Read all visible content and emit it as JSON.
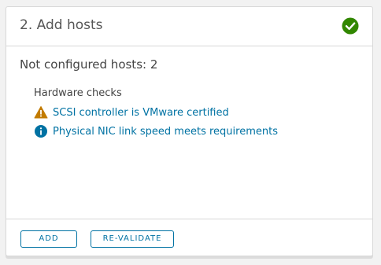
{
  "card": {
    "title": "2. Add hosts",
    "status_icon": "check-circle-icon",
    "status_color": "#318700",
    "summary": "Not configured hosts: 2",
    "hardware_checks": {
      "title": "Hardware checks",
      "items": [
        {
          "icon": "warning-icon",
          "icon_color": "#c27b00",
          "label": "SCSI controller is VMware certified"
        },
        {
          "icon": "info-icon",
          "icon_color": "#0072a3",
          "label": "Physical NIC link speed meets requirements"
        }
      ]
    }
  },
  "footer": {
    "add_label": "ADD",
    "revalidate_label": "RE-VALIDATE"
  },
  "colors": {
    "link": "#0072a3",
    "text": "#444444",
    "border": "#d8d8d8"
  }
}
